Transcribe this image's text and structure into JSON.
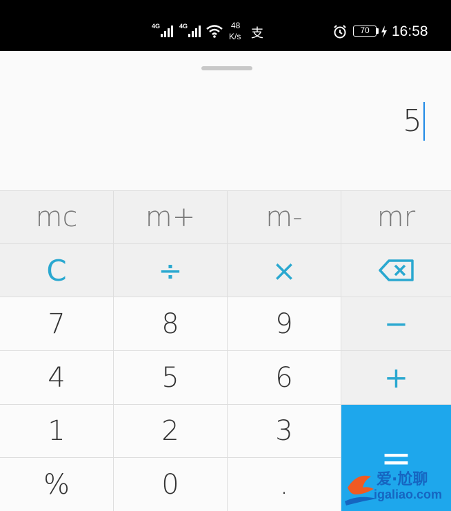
{
  "status_bar": {
    "net1": "4G",
    "net2": "4G",
    "speed_value": "48",
    "speed_unit": "K/s",
    "app_icon_char": "支",
    "battery": "70",
    "time": "16:58",
    "icons": [
      "signal-icon",
      "signal-icon",
      "wifi-icon",
      "alipay-icon",
      "alarm-icon",
      "battery-icon",
      "charging-icon"
    ]
  },
  "display": {
    "value": "5"
  },
  "keys": {
    "mc": "mc",
    "m_plus": "m+",
    "m_minus": "m-",
    "mr": "mr",
    "clear": "C",
    "divide": "÷",
    "multiply": "×",
    "seven": "7",
    "eight": "8",
    "nine": "9",
    "minus": "−",
    "four": "4",
    "five": "5",
    "six": "6",
    "plus": "+",
    "one": "1",
    "two": "2",
    "three": "3",
    "percent": "%",
    "zero": "0",
    "dot": ".",
    "equals": "="
  },
  "watermark": {
    "text_cn": "爱·尬聊",
    "url": "igaliao.com"
  },
  "colors": {
    "accent": "#2aa8d0",
    "equals_bg": "#1ea7ec",
    "cursor": "#1e88e5"
  }
}
